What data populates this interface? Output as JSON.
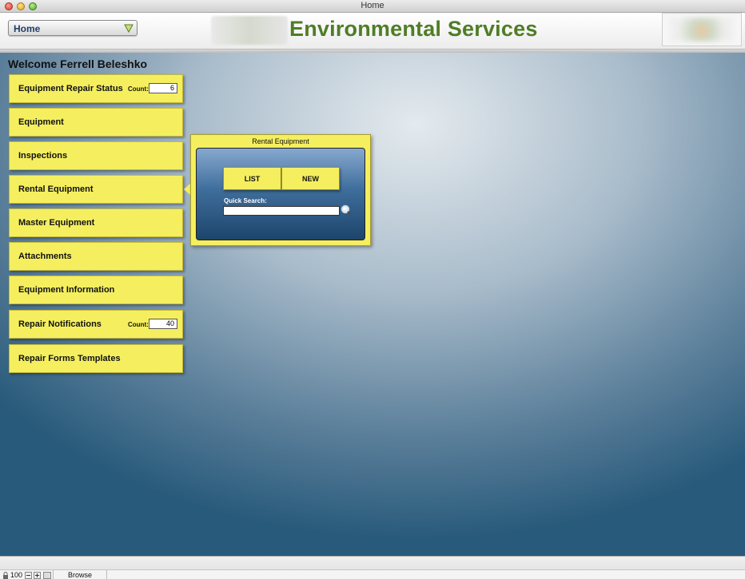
{
  "window": {
    "title": "Home"
  },
  "header": {
    "nav_dropdown_value": "Home",
    "brand_title": "Environmental Services"
  },
  "main": {
    "welcome": "Welcome Ferrell Beleshko",
    "nav_items": [
      {
        "label": "Equipment Repair Status",
        "count_label": "Count:",
        "count": "6"
      },
      {
        "label": "Equipment"
      },
      {
        "label": "Inspections"
      },
      {
        "label": "Rental Equipment"
      },
      {
        "label": "Master Equipment"
      },
      {
        "label": "Attachments"
      },
      {
        "label": "Equipment Information"
      },
      {
        "label": "Repair Notifications",
        "count_label": "Count:",
        "count": "40"
      },
      {
        "label": "Repair Forms Templates"
      }
    ]
  },
  "popover": {
    "title": "Rental Equipment",
    "list_label": "LIST",
    "new_label": "NEW",
    "quick_search_label": "Quick Search:",
    "quick_search_value": ""
  },
  "statusbar": {
    "zoom": "100",
    "mode": "Browse"
  },
  "colors": {
    "button_yellow": "#f5ef5f",
    "brand_green": "#4f7d26",
    "nav_blue": "#1e3f66",
    "panel_blue": "#3f6e9c"
  },
  "icons": {
    "dropdown": "chevron-down-icon",
    "search": "magnifier-icon",
    "lock": "lock-icon",
    "zoom_out": "zoom-out-icon",
    "zoom_in": "zoom-in-icon"
  }
}
